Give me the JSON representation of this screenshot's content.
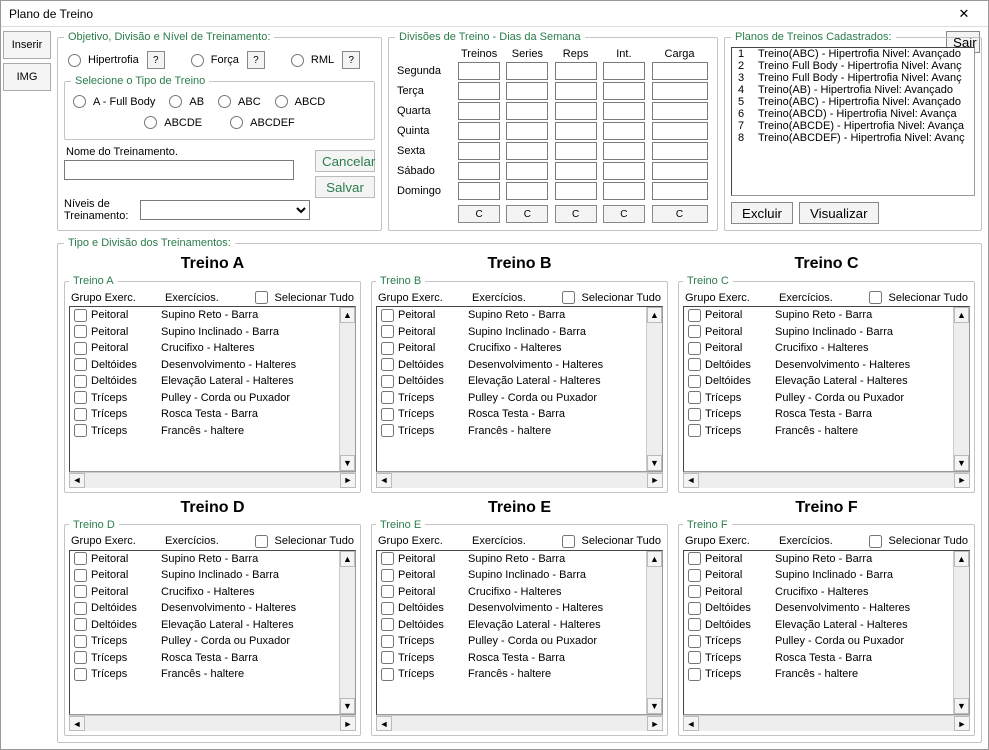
{
  "window": {
    "title": "Plano de Treino"
  },
  "sideTabs": {
    "inserir": "Inserir",
    "img": "IMG"
  },
  "sair_label": "Sair",
  "obj": {
    "legend": "Objetivo, Divisão e Nível de Treinamento:",
    "hipertrofia": "Hipertrofia",
    "forca": "Força",
    "rml": "RML",
    "q": "?",
    "tipoLegend": "Selecione o Tipo de Treino",
    "tipos": {
      "a": "A - Full Body",
      "ab": "AB",
      "abc": "ABC",
      "abcd": "ABCD",
      "abcde": "ABCDE",
      "abcdef": "ABCDEF"
    },
    "nomeLabel": "Nome do Treinamento.",
    "niveisLabel": "Níveis de Treinamento:",
    "cancelar": "Cancelar",
    "salvar": "Salvar"
  },
  "divsem": {
    "legend": "Divisões de Treino - Dias da Semana",
    "cols": {
      "treinos": "Treinos",
      "series": "Series",
      "reps": "Reps",
      "int": "Int.",
      "carga": "Carga"
    },
    "dias": [
      "Segunda",
      "Terça",
      "Quarta",
      "Quinta",
      "Sexta",
      "Sábado",
      "Domingo"
    ],
    "cbtn": "C"
  },
  "planos": {
    "legend": "Planos de Treinos Cadastrados:",
    "items": [
      {
        "n": "1",
        "t": "Treino(ABC) - Hipertrofia Nivel: Avançado"
      },
      {
        "n": "2",
        "t": "Treino Full Body - Hipertrofia Nivel: Avanç"
      },
      {
        "n": "3",
        "t": "Treino Full Body - Hipertrofia Nivel: Avanç"
      },
      {
        "n": "4",
        "t": "Treino(AB) - Hipertrofia Nivel: Avançado"
      },
      {
        "n": "5",
        "t": "Treino(ABC) - Hipertrofia Nivel: Avançado"
      },
      {
        "n": "6",
        "t": "Treino(ABCD) - Hipertrofia Nivel: Avança"
      },
      {
        "n": "7",
        "t": "Treino(ABCDE) - Hipertrofia Nivel: Avança"
      },
      {
        "n": "8",
        "t": "Treino(ABCDEF) - Hipertrofia Nivel: Avanç"
      }
    ],
    "excluir": "Excluir",
    "visualizar": "Visualizar"
  },
  "tipo": {
    "legend": "Tipo e Divisão dos Treinamentos:"
  },
  "treinos": [
    {
      "key": "A",
      "title": "Treino A",
      "legend": "Treino A"
    },
    {
      "key": "B",
      "title": "Treino B",
      "legend": "Treino B"
    },
    {
      "key": "C",
      "title": "Treino C",
      "legend": "Treino C"
    },
    {
      "key": "D",
      "title": "Treino D",
      "legend": "Treino D"
    },
    {
      "key": "E",
      "title": "Treino E",
      "legend": "Treino E"
    },
    {
      "key": "F",
      "title": "Treino F",
      "legend": "Treino F"
    }
  ],
  "treino_hdr": {
    "grupo": "Grupo Exerc.",
    "exerc": "Exercícios.",
    "seltudo": "Selecionar Tudo"
  },
  "exercicios": [
    {
      "g": "Peitoral",
      "e": "Supino Reto - Barra"
    },
    {
      "g": "Peitoral",
      "e": "Supino Inclinado - Barra"
    },
    {
      "g": "Peitoral",
      "e": "Crucifixo - Halteres"
    },
    {
      "g": "Deltóides",
      "e": "Desenvolvimento - Halteres"
    },
    {
      "g": "Deltóides",
      "e": "Elevação Lateral - Halteres"
    },
    {
      "g": "Tríceps",
      "e": "Pulley - Corda ou Puxador"
    },
    {
      "g": "Tríceps",
      "e": "Rosca Testa - Barra"
    },
    {
      "g": "Tríceps",
      "e": "Francês - haltere"
    }
  ]
}
